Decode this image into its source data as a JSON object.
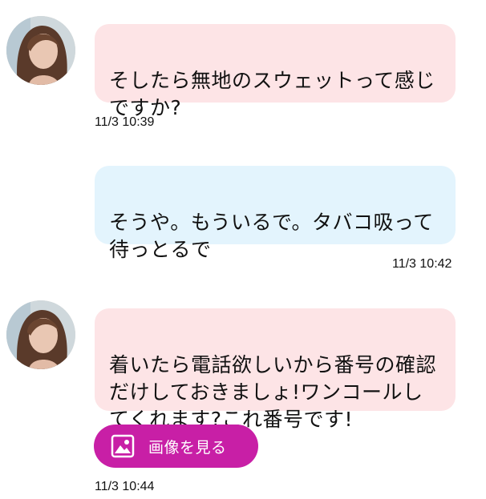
{
  "messages": [
    {
      "direction": "incoming",
      "text": "そしたら無地のスウェットって感じ\nですか?",
      "time": "11/3 10:39"
    },
    {
      "direction": "outgoing",
      "text": "そうや。もういるで。タバコ吸って\n待っとるで",
      "time": "11/3 10:42"
    },
    {
      "direction": "incoming",
      "text": "着いたら電話欲しいから番号の確認\nだけしておきましょ!ワンコールし\nてくれます?これ番号です!",
      "time": "11/3 10:44"
    }
  ],
  "image_button": {
    "label": "画像を見る",
    "icon": "image-icon"
  },
  "colors": {
    "incoming_bubble": "#fde4e6",
    "outgoing_bubble": "#e3f4fd",
    "image_button": "#c81fa6"
  }
}
